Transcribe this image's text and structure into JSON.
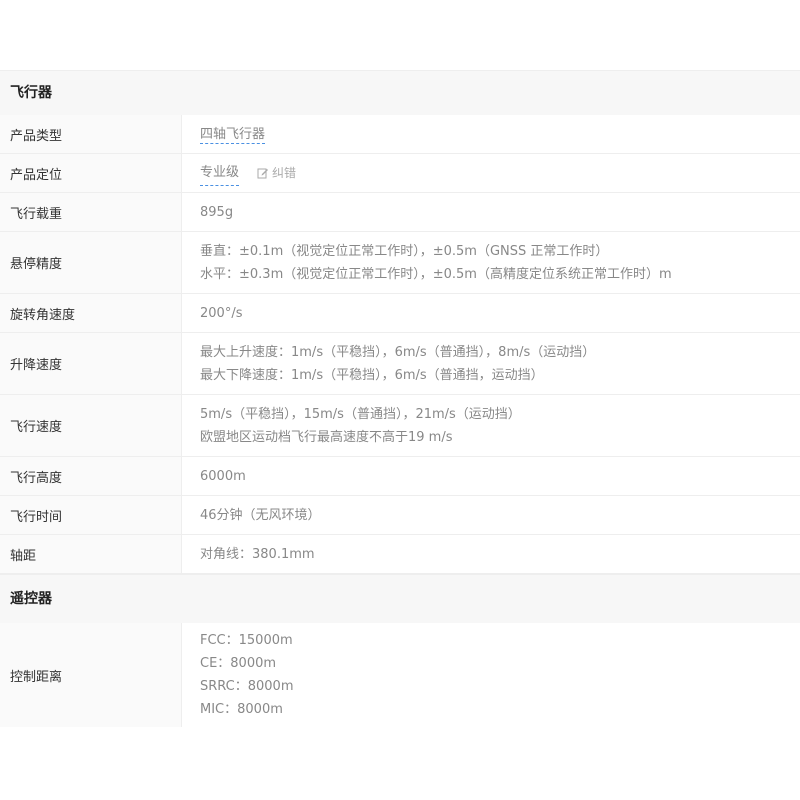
{
  "aircraft": {
    "title": "飞行器",
    "rows": [
      {
        "label": "产品类型",
        "value": "四轴飞行器"
      },
      {
        "label": "产品定位",
        "value": "专业级",
        "action": "纠错"
      },
      {
        "label": "飞行载重",
        "value": "895g"
      },
      {
        "label": "悬停精度",
        "lines": [
          "垂直：±0.1m（视觉定位正常工作时），±0.5m（GNSS 正常工作时）",
          "水平：±0.3m（视觉定位正常工作时），±0.5m（高精度定位系统正常工作时）m"
        ]
      },
      {
        "label": "旋转角速度",
        "value": "200°/s"
      },
      {
        "label": "升降速度",
        "lines": [
          "最大上升速度：1m/s（平稳挡），6m/s（普通挡），8m/s（运动挡）",
          "最大下降速度：1m/s（平稳挡），6m/s（普通挡，运动挡）"
        ]
      },
      {
        "label": "飞行速度",
        "lines": [
          "5m/s（平稳挡），15m/s（普通挡），21m/s（运动挡）",
          "欧盟地区运动档飞行最高速度不高于19 m/s"
        ]
      },
      {
        "label": "飞行高度",
        "value": "6000m"
      },
      {
        "label": "飞行时间",
        "value": "46分钟（无风环境）"
      },
      {
        "label": "轴距",
        "value": "对角线：380.1mm"
      }
    ]
  },
  "remote": {
    "title": "遥控器",
    "rows": [
      {
        "label": "控制距离",
        "lines": [
          "FCC：15000m",
          "CE：8000m",
          "SRRC：8000m",
          "MIC：8000m"
        ]
      }
    ]
  }
}
